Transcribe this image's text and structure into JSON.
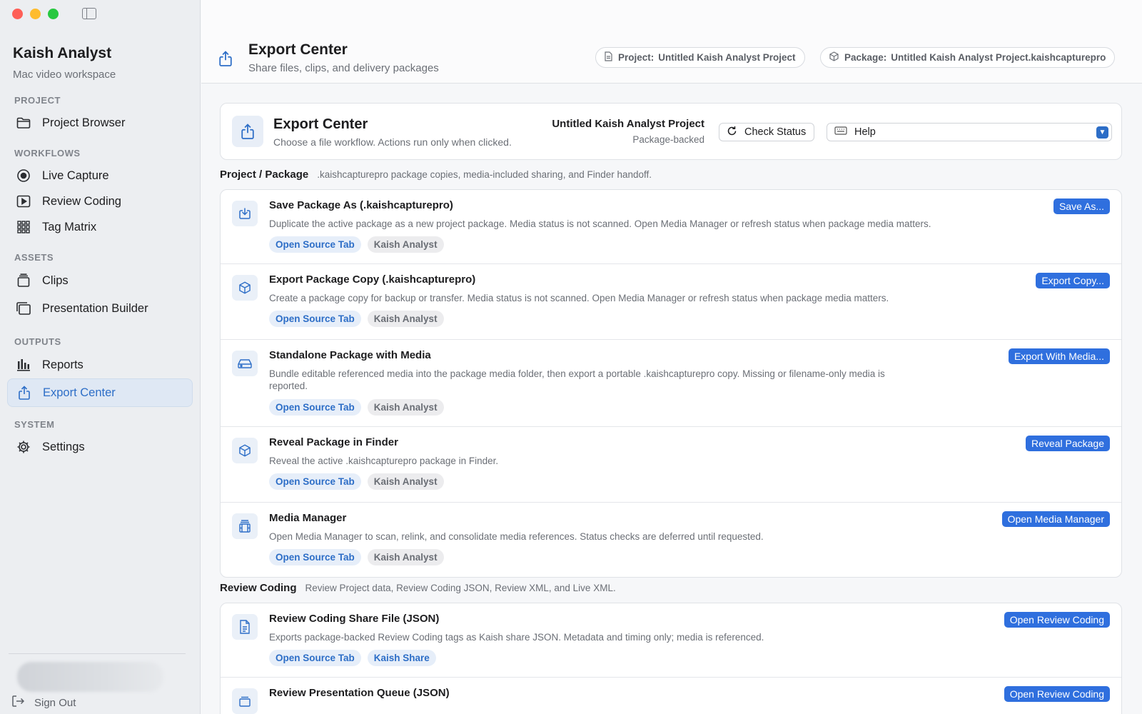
{
  "sidebar": {
    "app_title": "Kaish Analyst",
    "app_subtitle": "Mac video workspace",
    "sections": [
      {
        "label": "PROJECT"
      },
      {
        "label": "WORKFLOWS"
      },
      {
        "label": "ASSETS"
      },
      {
        "label": "OUTPUTS"
      },
      {
        "label": "SYSTEM"
      }
    ],
    "items": {
      "project_browser": "Project Browser",
      "live_capture": "Live Capture",
      "review_coding": "Review Coding",
      "tag_matrix": "Tag Matrix",
      "clips": "Clips",
      "presentation_builder": "Presentation Builder",
      "reports": "Reports",
      "export_center": "Export Center",
      "settings": "Settings"
    },
    "active_item": "Export Center",
    "sign_out": "Sign Out"
  },
  "header": {
    "title": "Export Center",
    "subtitle": "Share files, clips, and delivery packages",
    "project_key": "Project:",
    "project_value": "Untitled Kaish Analyst Project",
    "package_key": "Package:",
    "package_value": "Untitled Kaish Analyst Project.kaishcapturepro"
  },
  "hero": {
    "title": "Export Center",
    "subtitle": "Choose a file workflow. Actions run only when clicked.",
    "project_name": "Untitled Kaish Analyst Project",
    "project_mode": "Package-backed",
    "check_status": "Check Status",
    "help_value": "Help"
  },
  "groups": {
    "project_package": {
      "title": "Project / Package",
      "description": ".kaishcapturepro package copies, media-included sharing, and Finder handoff.",
      "rows": [
        {
          "title": "Save Package As (.kaishcapturepro)",
          "description": "Duplicate the active package as a new project package. Media status is not scanned. Open Media Manager or refresh status when package media matters.",
          "tag1": "Open Source Tab",
          "tag2": "Kaish Analyst",
          "button": "Save As...",
          "icon": "download-icon"
        },
        {
          "title": "Export Package Copy (.kaishcapturepro)",
          "description": "Create a package copy for backup or transfer. Media status is not scanned. Open Media Manager or refresh status when package media matters.",
          "tag1": "Open Source Tab",
          "tag2": "Kaish Analyst",
          "button": "Export Copy...",
          "icon": "cube-icon"
        },
        {
          "title": "Standalone Package with Media",
          "description": "Bundle editable referenced media into the package media folder, then export a portable .kaishcapturepro copy. Missing or filename-only media is reported.",
          "tag1": "Open Source Tab",
          "tag2": "Kaish Analyst",
          "button": "Export With Media...",
          "icon": "drive-icon"
        },
        {
          "title": "Reveal Package in Finder",
          "description": "Reveal the active .kaishcapturepro package in Finder.",
          "tag1": "Open Source Tab",
          "tag2": "Kaish Analyst",
          "button": "Reveal Package",
          "icon": "cube-icon"
        },
        {
          "title": "Media Manager",
          "description": "Open Media Manager to scan, relink, and consolidate media references. Status checks are deferred until requested.",
          "tag1": "Open Source Tab",
          "tag2": "Kaish Analyst",
          "button": "Open Media Manager",
          "icon": "film-stack-icon"
        }
      ]
    },
    "review_coding": {
      "title": "Review Coding",
      "description": "Review Project data, Review Coding JSON, Review XML, and Live XML.",
      "rows": [
        {
          "title": "Review Coding Share File (JSON)",
          "description": "Exports package-backed Review Coding tags as Kaish share JSON. Metadata and timing only; media is referenced.",
          "tag1": "Open Source Tab",
          "tag2": "Kaish Share",
          "button": "Open Review Coding",
          "icon": "document-icon"
        },
        {
          "title": "Review Presentation Queue (JSON)",
          "description": "",
          "tag1": "",
          "tag2": "",
          "button": "Open Review Coding",
          "icon": "stack-icon"
        }
      ]
    }
  },
  "colors": {
    "accent": "#2d6ec7",
    "button": "#2f6fde",
    "active_bg": "#dfe8f4"
  }
}
